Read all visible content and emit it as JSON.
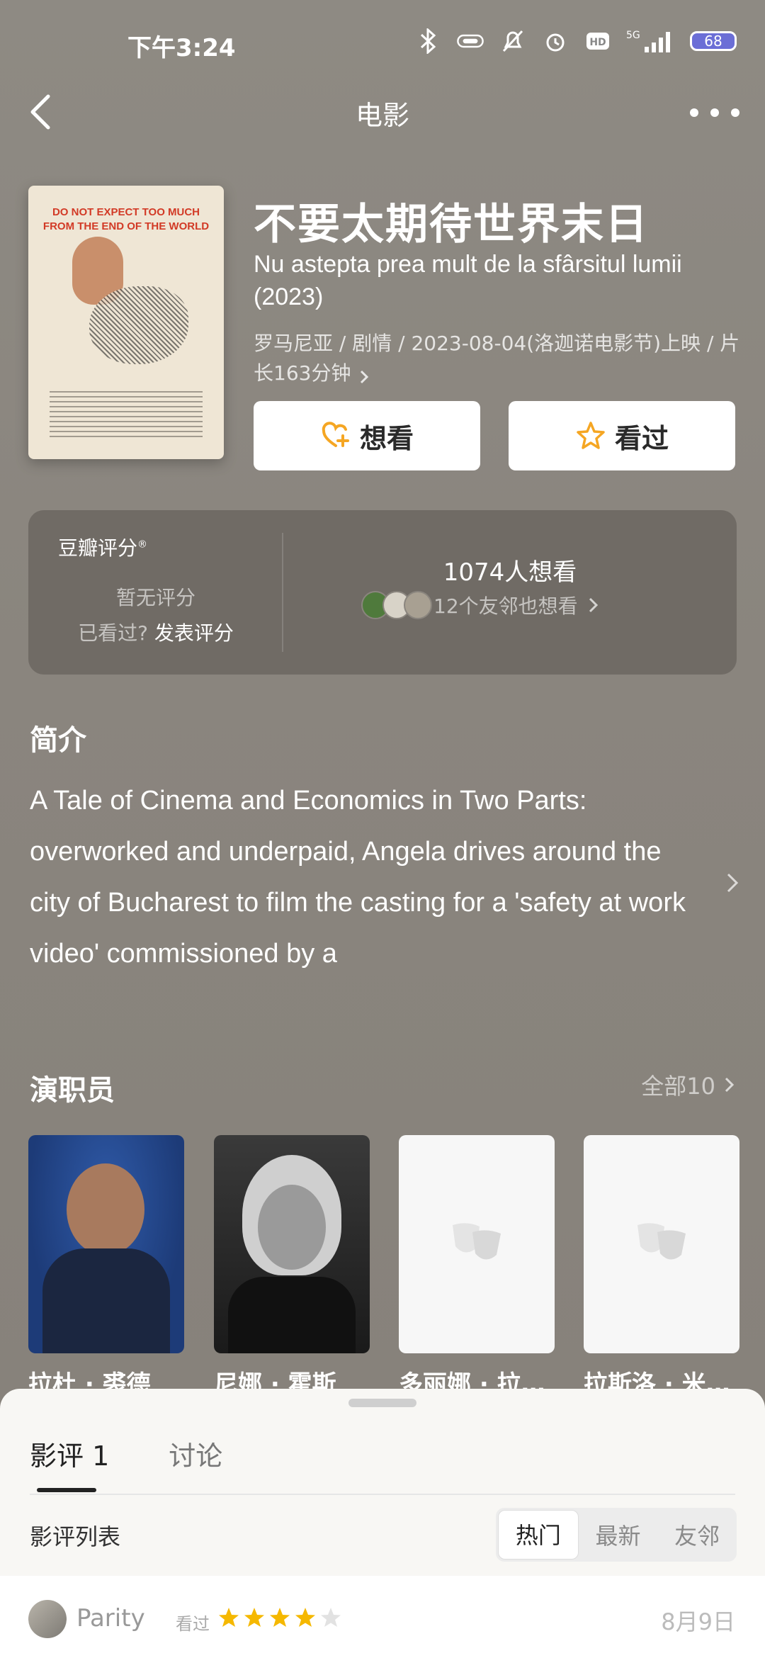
{
  "status": {
    "time": "下午3:24",
    "battery": "68",
    "signal": "5G"
  },
  "nav": {
    "title": "电影"
  },
  "movie": {
    "title_cn": "不要太期待世界末日",
    "title_orig": "Nu astepta prea mult de la sfârsitul lumii (2023)",
    "meta": "罗马尼亚 / 剧情 / 2023-08-04(洛迦诺电影节)上映 / 片长163分钟",
    "poster_title": "DO NOT EXPECT TOO MUCH FROM THE END OF THE WORLD",
    "want_label": "想看",
    "seen_label": "看过"
  },
  "rating": {
    "brand": "豆瓣评分",
    "no_rating": "暂无评分",
    "seen_prompt": "已看过?",
    "post_rating": "发表评分",
    "want_count": "1074人想看",
    "friends_want": "12个友邻也想看"
  },
  "synopsis": {
    "title": "简介",
    "text": "A Tale of Cinema and Economics in Two Parts: overworked and underpaid, Angela drives around the city of Bucharest to film the casting for a 'safety at work video' commissioned by a"
  },
  "cast": {
    "title": "演职员",
    "all_label": "全部10",
    "members": [
      {
        "name": "拉杜 · 裘德"
      },
      {
        "name": "尼娜 · 霍斯"
      },
      {
        "name": "多丽娜 · 拉…"
      },
      {
        "name": "拉斯洛 · 米…"
      }
    ]
  },
  "sheet": {
    "tab_reviews": "影评 1",
    "tab_discussion": "讨论",
    "list_label": "影评列表",
    "sort_options": [
      "热门",
      "最新",
      "友邻"
    ],
    "review": {
      "user": "Parity",
      "seen": "看过",
      "stars": 4,
      "date": "8月9日"
    }
  },
  "colors": {
    "star": "#f5b800",
    "want_icon": "#f5a623"
  }
}
